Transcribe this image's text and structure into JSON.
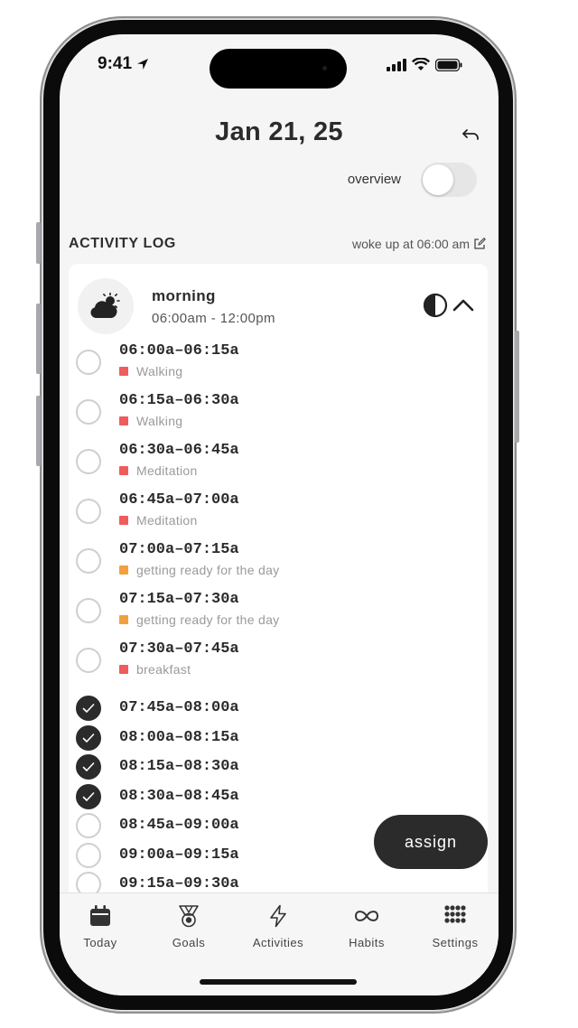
{
  "status_bar": {
    "time": "9:41"
  },
  "header": {
    "title": "Jan 21, 25",
    "overview_label": "overview",
    "overview_on": false
  },
  "activity_log": {
    "title": "ACTIVITY LOG",
    "woke_text": "woke up at 06:00 am"
  },
  "period": {
    "name": "morning",
    "range": "06:00am - 12:00pm"
  },
  "slots": [
    {
      "time": "06:00a–06:15a",
      "activity": "Walking",
      "color": "#ee5c5c",
      "done": false
    },
    {
      "time": "06:15a–06:30a",
      "activity": "Walking",
      "color": "#ee5c5c",
      "done": false
    },
    {
      "time": "06:30a–06:45a",
      "activity": "Meditation",
      "color": "#ee5c5c",
      "done": false
    },
    {
      "time": "06:45a–07:00a",
      "activity": "Meditation",
      "color": "#ee5c5c",
      "done": false
    },
    {
      "time": "07:00a–07:15a",
      "activity": "getting ready for the day",
      "color": "#f2a03d",
      "done": false
    },
    {
      "time": "07:15a–07:30a",
      "activity": "getting ready for the day",
      "color": "#f2a03d",
      "done": false
    },
    {
      "time": "07:30a–07:45a",
      "activity": "breakfast",
      "color": "#ee5c5c",
      "done": false
    },
    {
      "time": "07:45a–08:00a",
      "activity": "",
      "color": "",
      "done": true
    },
    {
      "time": "08:00a–08:15a",
      "activity": "",
      "color": "",
      "done": true
    },
    {
      "time": "08:15a–08:30a",
      "activity": "",
      "color": "",
      "done": true
    },
    {
      "time": "08:30a–08:45a",
      "activity": "",
      "color": "",
      "done": true
    },
    {
      "time": "08:45a–09:00a",
      "activity": "",
      "color": "",
      "done": false
    },
    {
      "time": "09:00a–09:15a",
      "activity": "",
      "color": "",
      "done": false
    },
    {
      "time": "09:15a–09:30a",
      "activity": "",
      "color": "",
      "done": false
    }
  ],
  "assign_label": "assign",
  "tabs": [
    {
      "label": "Today",
      "icon": "calendar-icon"
    },
    {
      "label": "Goals",
      "icon": "medal-icon"
    },
    {
      "label": "Activities",
      "icon": "lightning-icon"
    },
    {
      "label": "Habits",
      "icon": "infinity-icon"
    },
    {
      "label": "Settings",
      "icon": "grid-dots-icon"
    }
  ]
}
